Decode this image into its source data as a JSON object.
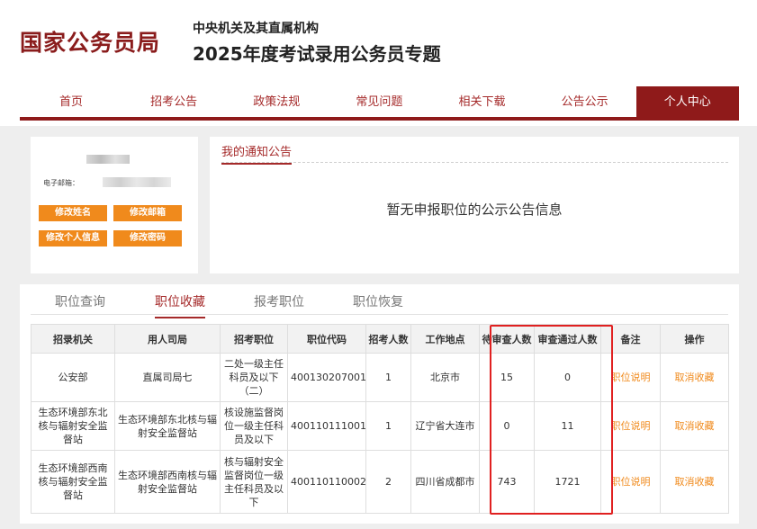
{
  "header": {
    "logo": "国家公务员局",
    "subtitle_line1": "中央机关及其直属机构",
    "subtitle_line2": "2025年度考试录用公务员专题"
  },
  "nav": {
    "items": [
      "首页",
      "招考公告",
      "政策法规",
      "常见问题",
      "相关下载",
      "公告公示",
      "个人中心"
    ],
    "active": "个人中心"
  },
  "profile": {
    "email_label": "电子邮箱：",
    "buttons": {
      "edit_name": "修改姓名",
      "edit_email": "修改邮箱",
      "edit_info": "修改个人信息",
      "edit_password": "修改密码"
    }
  },
  "notice": {
    "title": "我的通知公告",
    "empty_message": "暂无申报职位的公示公告信息"
  },
  "tabs": {
    "items": [
      "职位查询",
      "职位收藏",
      "报考职位",
      "职位恢复"
    ],
    "active": "职位收藏"
  },
  "table": {
    "headers": [
      "招录机关",
      "用人司局",
      "招考职位",
      "职位代码",
      "招考人数",
      "工作地点",
      "待审查人数",
      "审查通过人数",
      "备注",
      "操作"
    ],
    "rows": [
      [
        "公安部",
        "直属司局七",
        "二处一级主任科员及以下（二）",
        "400130207001",
        "1",
        "北京市",
        "15",
        "0",
        "职位说明",
        "取消收藏"
      ],
      [
        "生态环境部东北核与辐射安全监督站",
        "生态环境部东北核与辐射安全监督站",
        "核设施监督岗位一级主任科员及以下",
        "400110111001",
        "1",
        "辽宁省大连市",
        "0",
        "11",
        "职位说明",
        "取消收藏"
      ],
      [
        "生态环境部西南核与辐射安全监督站",
        "生态环境部西南核与辐射安全监督站",
        "核与辐射安全监督岗位一级主任科员及以下",
        "400110110002",
        "2",
        "四川省成都市",
        "743",
        "1721",
        "职位说明",
        "取消收藏"
      ]
    ]
  },
  "colors": {
    "brand_red": "#8f1a1a",
    "accent_orange": "#f08a1c",
    "highlight_box": "#e02020"
  }
}
